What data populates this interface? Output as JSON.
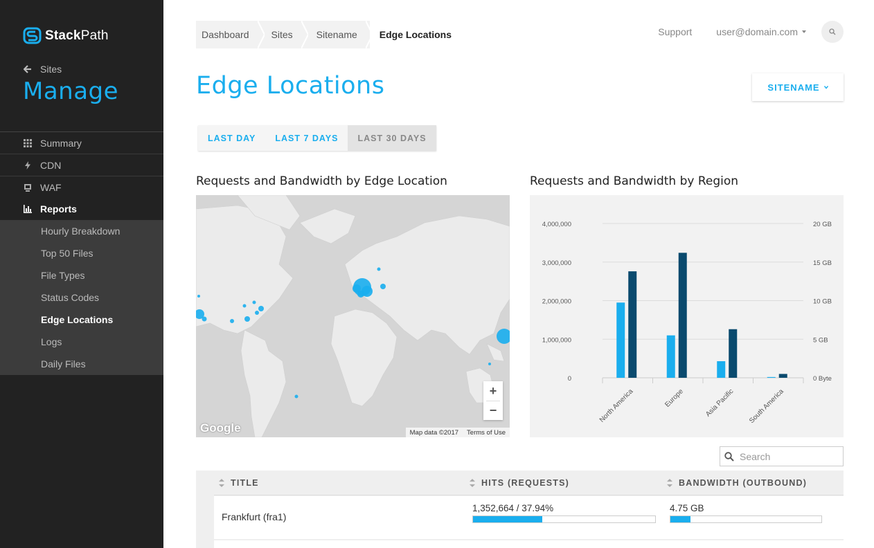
{
  "brand": {
    "name_bold": "Stack",
    "name_light": "Path",
    "accent": "#1aaeee"
  },
  "sidebar": {
    "back_label": "Sites",
    "section_title": "Manage",
    "items": [
      {
        "label": "Summary",
        "icon": "grid-icon"
      },
      {
        "label": "CDN",
        "icon": "bolt-icon"
      },
      {
        "label": "WAF",
        "icon": "shield-icon"
      },
      {
        "label": "Reports",
        "icon": "bar-chart-icon"
      }
    ],
    "sub_items": [
      {
        "label": "Hourly Breakdown"
      },
      {
        "label": "Top 50 Files"
      },
      {
        "label": "File Types"
      },
      {
        "label": "Status Codes"
      },
      {
        "label": "Edge Locations"
      },
      {
        "label": "Logs"
      },
      {
        "label": "Daily Files"
      }
    ]
  },
  "breadcrumb": [
    "Dashboard",
    "Sites",
    "Sitename",
    "Edge Locations"
  ],
  "topnav": {
    "support": "Support",
    "user": "user@domain.com"
  },
  "page": {
    "title": "Edge Locations",
    "site_select": "SITENAME"
  },
  "ranges": [
    "LAST DAY",
    "LAST 7 DAYS",
    "LAST 30 DAYS"
  ],
  "map_panel": {
    "title": "Requests and Bandwidth by Edge Location",
    "logo": "Google",
    "attribution": "Map data ©2017",
    "terms": "Terms of Use"
  },
  "chart_panel": {
    "title": "Requests and Bandwidth by Region"
  },
  "chart_data": {
    "type": "bar",
    "categories": [
      "North America",
      "Europe",
      "Asia Pacific",
      "South America"
    ],
    "series": [
      {
        "values": [
          1950000,
          1100000,
          430000,
          20000
        ],
        "color": "#1aaeee",
        "axis": "left"
      },
      {
        "values": [
          13.8,
          16.2,
          6.3,
          0.5
        ],
        "color": "#0a4a6e",
        "axis": "right"
      }
    ],
    "y_left": {
      "ticks": [
        "4,000,000",
        "3,000,000",
        "2,000,000",
        "1,000,000",
        "0"
      ],
      "ylim": [
        0,
        4000000
      ]
    },
    "y_right": {
      "ticks": [
        "20 GB",
        "15 GB",
        "10 GB",
        "5 GB",
        "0 Byte"
      ],
      "ylim": [
        0,
        20
      ]
    },
    "grid": true
  },
  "table": {
    "search_placeholder": "Search",
    "columns": [
      "TITLE",
      "HITS (REQUESTS)",
      "BANDWIDTH (OUTBOUND)"
    ],
    "rows": [
      {
        "title": "Frankfurt (fra1)",
        "hits": "1,352,664 / 37.94%",
        "hits_pct": 37.94,
        "bandwidth": "4.75 GB",
        "bandwidth_pct": 13.5
      }
    ]
  }
}
